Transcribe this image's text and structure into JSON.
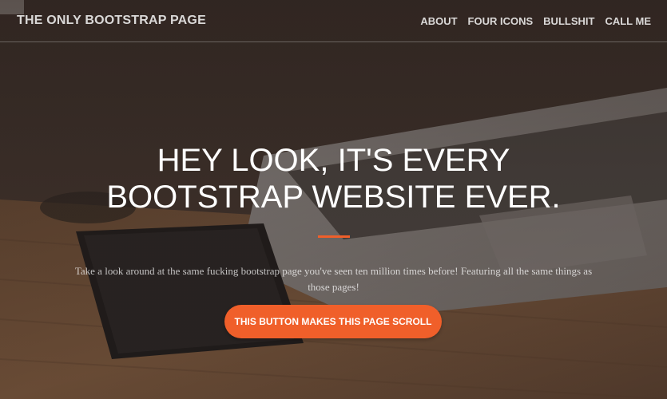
{
  "navbar": {
    "brand": "THE ONLY BOOTSTRAP PAGE",
    "links": [
      {
        "label": "ABOUT"
      },
      {
        "label": "FOUR ICONS"
      },
      {
        "label": "BULLSHIT"
      },
      {
        "label": "CALL ME"
      }
    ]
  },
  "hero": {
    "headline_line1": "HEY LOOK, IT'S EVERY",
    "headline_line2": "BOOTSTRAP WEBSITE EVER.",
    "lead": "Take a look around at the same fucking bootstrap page you've seen ten million times before! Featuring all the same things as those pages!",
    "cta_label": "THIS BUTTON MAKES THIS PAGE SCROLL"
  },
  "colors": {
    "accent": "#f05f2a",
    "overlay": "#2b2522",
    "text": "#ffffff"
  }
}
